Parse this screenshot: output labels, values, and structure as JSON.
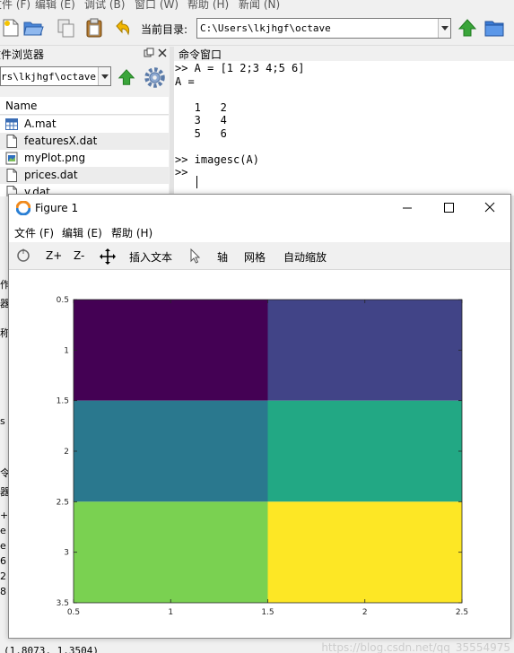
{
  "menubar": [
    "文件 (F)",
    "编辑 (E)",
    "调试 (B)",
    "窗口 (W)",
    "帮助 (H)",
    "新闻 (N)"
  ],
  "toolbar": {
    "current_dir_label": "当前目录:",
    "current_dir_value": "C:\\Users\\lkjhgf\\octave"
  },
  "file_browser": {
    "title": "文件浏览器",
    "path_value": "C:\\Users\\lkjhgf\\octave",
    "column_header": "Name",
    "files": [
      {
        "name": "A.mat",
        "icon": "table-icon"
      },
      {
        "name": "featuresX.dat",
        "icon": "file-icon"
      },
      {
        "name": "myPlot.png",
        "icon": "image-icon"
      },
      {
        "name": "prices.dat",
        "icon": "file-icon"
      },
      {
        "name": "y.dat",
        "icon": "file-icon"
      }
    ]
  },
  "command_window": {
    "title": "命令窗口",
    "lines": [
      ">> A = [1 2;3 4;5 6]",
      "A =",
      "",
      "   1   2",
      "   3   4",
      "   5   6",
      "",
      ">> imagesc(A)",
      ">> "
    ]
  },
  "left_remnants": [
    "作",
    "器",
    "称",
    "s",
    "令",
    "器",
    "+",
    "e",
    "e",
    "6",
    "2",
    "8"
  ],
  "statusbar": {
    "coords": "(1.8073, 1.3504)",
    "watermark": "https://blog.csdn.net/qq_35554975"
  },
  "figure": {
    "title": "Figure 1",
    "menu": [
      "文件 (F)",
      "编辑 (E)",
      "帮助 (H)"
    ],
    "toolbar": {
      "zoom_in": "Z+",
      "zoom_out": "Z-",
      "insert_text": "插入文本",
      "axis": "轴",
      "grid": "网格",
      "autoscale": "自动缩放"
    }
  },
  "chart_data": {
    "type": "heatmap",
    "matrix": [
      [
        1,
        2
      ],
      [
        3,
        4
      ],
      [
        5,
        6
      ]
    ],
    "colormap": "viridis",
    "cell_colors": [
      [
        "#440154",
        "#414487"
      ],
      [
        "#2a788e",
        "#22a884"
      ],
      [
        "#7ad151",
        "#fde725"
      ]
    ],
    "xlim": [
      0.5,
      2.5
    ],
    "ylim": [
      0.5,
      3.5
    ],
    "y_reversed": true,
    "xticks": [
      "0.5",
      "1",
      "1.5",
      "2",
      "2.5"
    ],
    "yticks": [
      "0.5",
      "1",
      "1.5",
      "2",
      "2.5",
      "3",
      "3.5"
    ]
  },
  "colors": {
    "accent_green": "#3aa53a",
    "folder_blue": "#3a7bd5"
  }
}
